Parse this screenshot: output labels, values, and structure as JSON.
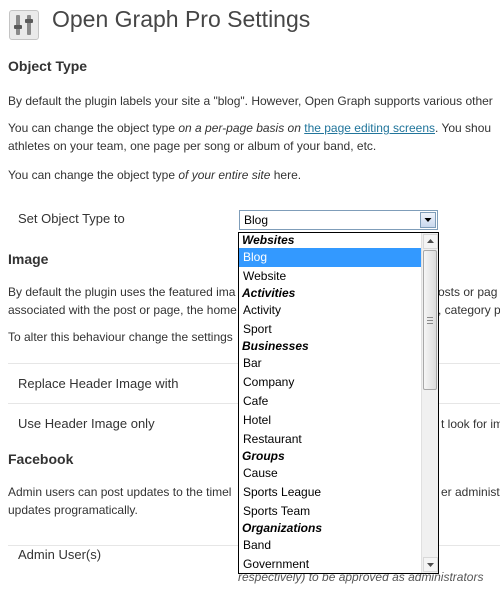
{
  "page": {
    "title": "Open Graph Pro Settings"
  },
  "object_type": {
    "heading": "Object Type",
    "para1": "By default the plugin labels your site a \"blog\". However, Open Graph supports various other",
    "para2_a": "You can change the object type ",
    "para2_em": "on a per-page basis on ",
    "para2_link": "the page editing screens",
    "para2_b": ". You shou",
    "para2_line2": "athletes on your team, one page per song or album of your band, etc.",
    "para3_a": "You can change the object type ",
    "para3_em": "of your entire site",
    "para3_b": " here.",
    "set_label": "Set Object Type to",
    "selected": "Blog"
  },
  "dropdown": {
    "options": [
      {
        "label": "Websites",
        "group": true
      },
      {
        "label": "Blog",
        "selected": true
      },
      {
        "label": "Website"
      },
      {
        "label": "Activities",
        "group": true
      },
      {
        "label": "Activity"
      },
      {
        "label": "Sport"
      },
      {
        "label": "Businesses",
        "group": true
      },
      {
        "label": "Bar"
      },
      {
        "label": "Company"
      },
      {
        "label": "Cafe"
      },
      {
        "label": "Hotel"
      },
      {
        "label": "Restaurant"
      },
      {
        "label": "Groups",
        "group": true
      },
      {
        "label": "Cause"
      },
      {
        "label": "Sports League"
      },
      {
        "label": "Sports Team"
      },
      {
        "label": "Organizations",
        "group": true
      },
      {
        "label": "Band"
      },
      {
        "label": "Government"
      }
    ]
  },
  "image": {
    "heading": "Image",
    "para1_a": "By default the plugin uses the featured ima",
    "para1_b": "osts or pag",
    "para2_a": "associated with the post or page, the home",
    "para2_b": ", category p",
    "para3": "To alter this behaviour change the settings",
    "replace_label": "Replace Header Image with",
    "use_only_label": "Use Header Image only",
    "use_only_tail": "t look for im"
  },
  "facebook": {
    "heading": "Facebook",
    "para1_a": "Admin users can post updates to the timel",
    "para1_b": "er administ",
    "para2": "updates programatically.",
    "admin_label": "Admin User(s)",
    "admin_hint": "respectively) to be approved as administrators"
  },
  "colors": {
    "selection": "#3399ff",
    "link": "#21759b"
  }
}
